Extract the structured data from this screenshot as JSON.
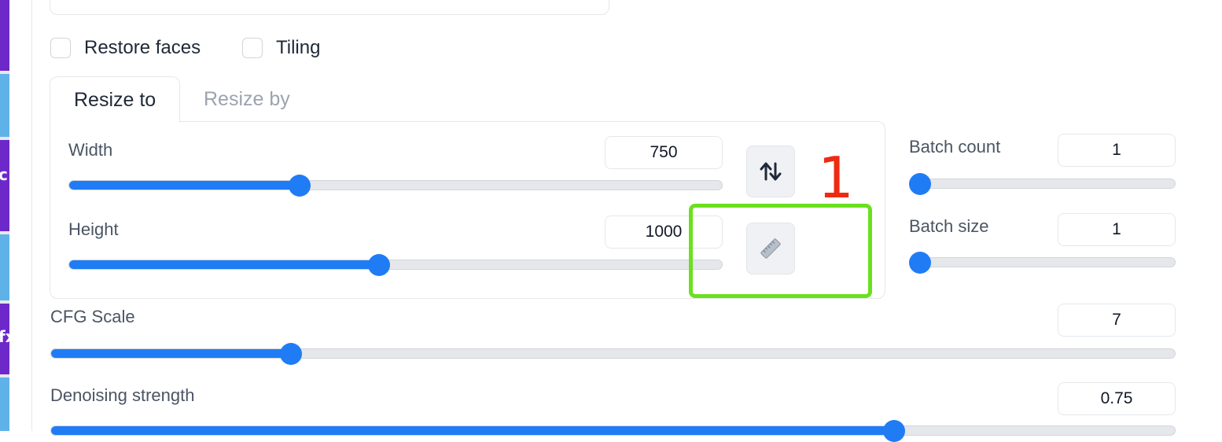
{
  "sidebar_fragments": [
    "c",
    "fx"
  ],
  "options": {
    "restore_faces": {
      "label": "Restore faces",
      "checked": false
    },
    "tiling": {
      "label": "Tiling",
      "checked": false
    }
  },
  "tabs": [
    {
      "label": "Resize to",
      "active": true
    },
    {
      "label": "Resize by",
      "active": false
    }
  ],
  "width": {
    "label": "Width",
    "value": "750",
    "fraction": 0.353
  },
  "height": {
    "label": "Height",
    "value": "1000",
    "fraction": 0.475
  },
  "batch_count": {
    "label": "Batch count",
    "value": "1",
    "fraction": 0.0
  },
  "batch_size": {
    "label": "Batch size",
    "value": "1",
    "fraction": 0.0
  },
  "cfg_scale": {
    "label": "CFG Scale",
    "value": "7",
    "fraction": 0.214
  },
  "denoising": {
    "label": "Denoising strength",
    "value": "0.75",
    "fraction": 0.75
  },
  "tools": {
    "swap_icon": "swap-arrows-icon",
    "ruler_icon": "ruler-icon"
  },
  "annotation": {
    "marker": "1",
    "highlight_color": "#6be01f",
    "marker_color": "#ee2a12"
  },
  "colors": {
    "accent": "#1f7cf5",
    "border": "#e5e7eb"
  }
}
